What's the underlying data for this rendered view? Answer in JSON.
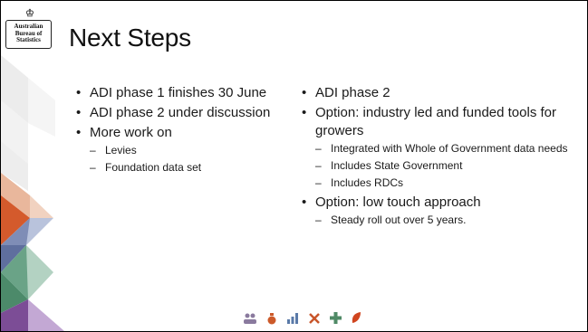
{
  "logo": {
    "lines": [
      "Australian",
      "Bureau of",
      "Statistics"
    ]
  },
  "title": "Next Steps",
  "left_column": [
    {
      "level": 1,
      "text": "ADI phase 1 finishes 30 June"
    },
    {
      "level": 1,
      "text": "ADI phase 2 under discussion"
    },
    {
      "level": 1,
      "text": "More work on"
    },
    {
      "level": 2,
      "text": "Levies"
    },
    {
      "level": 2,
      "text": "Foundation data set"
    }
  ],
  "right_column": [
    {
      "level": 1,
      "text": "ADI phase 2"
    },
    {
      "level": 1,
      "text": "Option: industry led and funded tools for growers"
    },
    {
      "level": 2,
      "text": "Integrated with Whole of Government data needs"
    },
    {
      "level": 2,
      "text": "Includes State Government"
    },
    {
      "level": 2,
      "text": "Includes RDCs"
    },
    {
      "level": 1,
      "text": "Option: low touch approach"
    },
    {
      "level": 2,
      "text": "Steady roll out over 5 years."
    }
  ],
  "footer_icons": [
    {
      "name": "people-icon",
      "color": "#8a7a9e"
    },
    {
      "name": "money-bag-icon",
      "color": "#cc5a2a"
    },
    {
      "name": "bar-chart-icon",
      "color": "#5a7aa8"
    },
    {
      "name": "tools-icon",
      "color": "#c8552a"
    },
    {
      "name": "plus-icon",
      "color": "#4f8a66"
    },
    {
      "name": "leaf-icon",
      "color": "#d0451f"
    }
  ],
  "colors": {
    "orange": "#d45a2c",
    "peach": "#e9b79c",
    "blue": "#5f6f9e",
    "light_blue": "#b9c3dc",
    "green": "#4c8a6a",
    "light_green": "#b3d2c2",
    "purple": "#7c4d96",
    "light_purple": "#c3a8d4"
  }
}
